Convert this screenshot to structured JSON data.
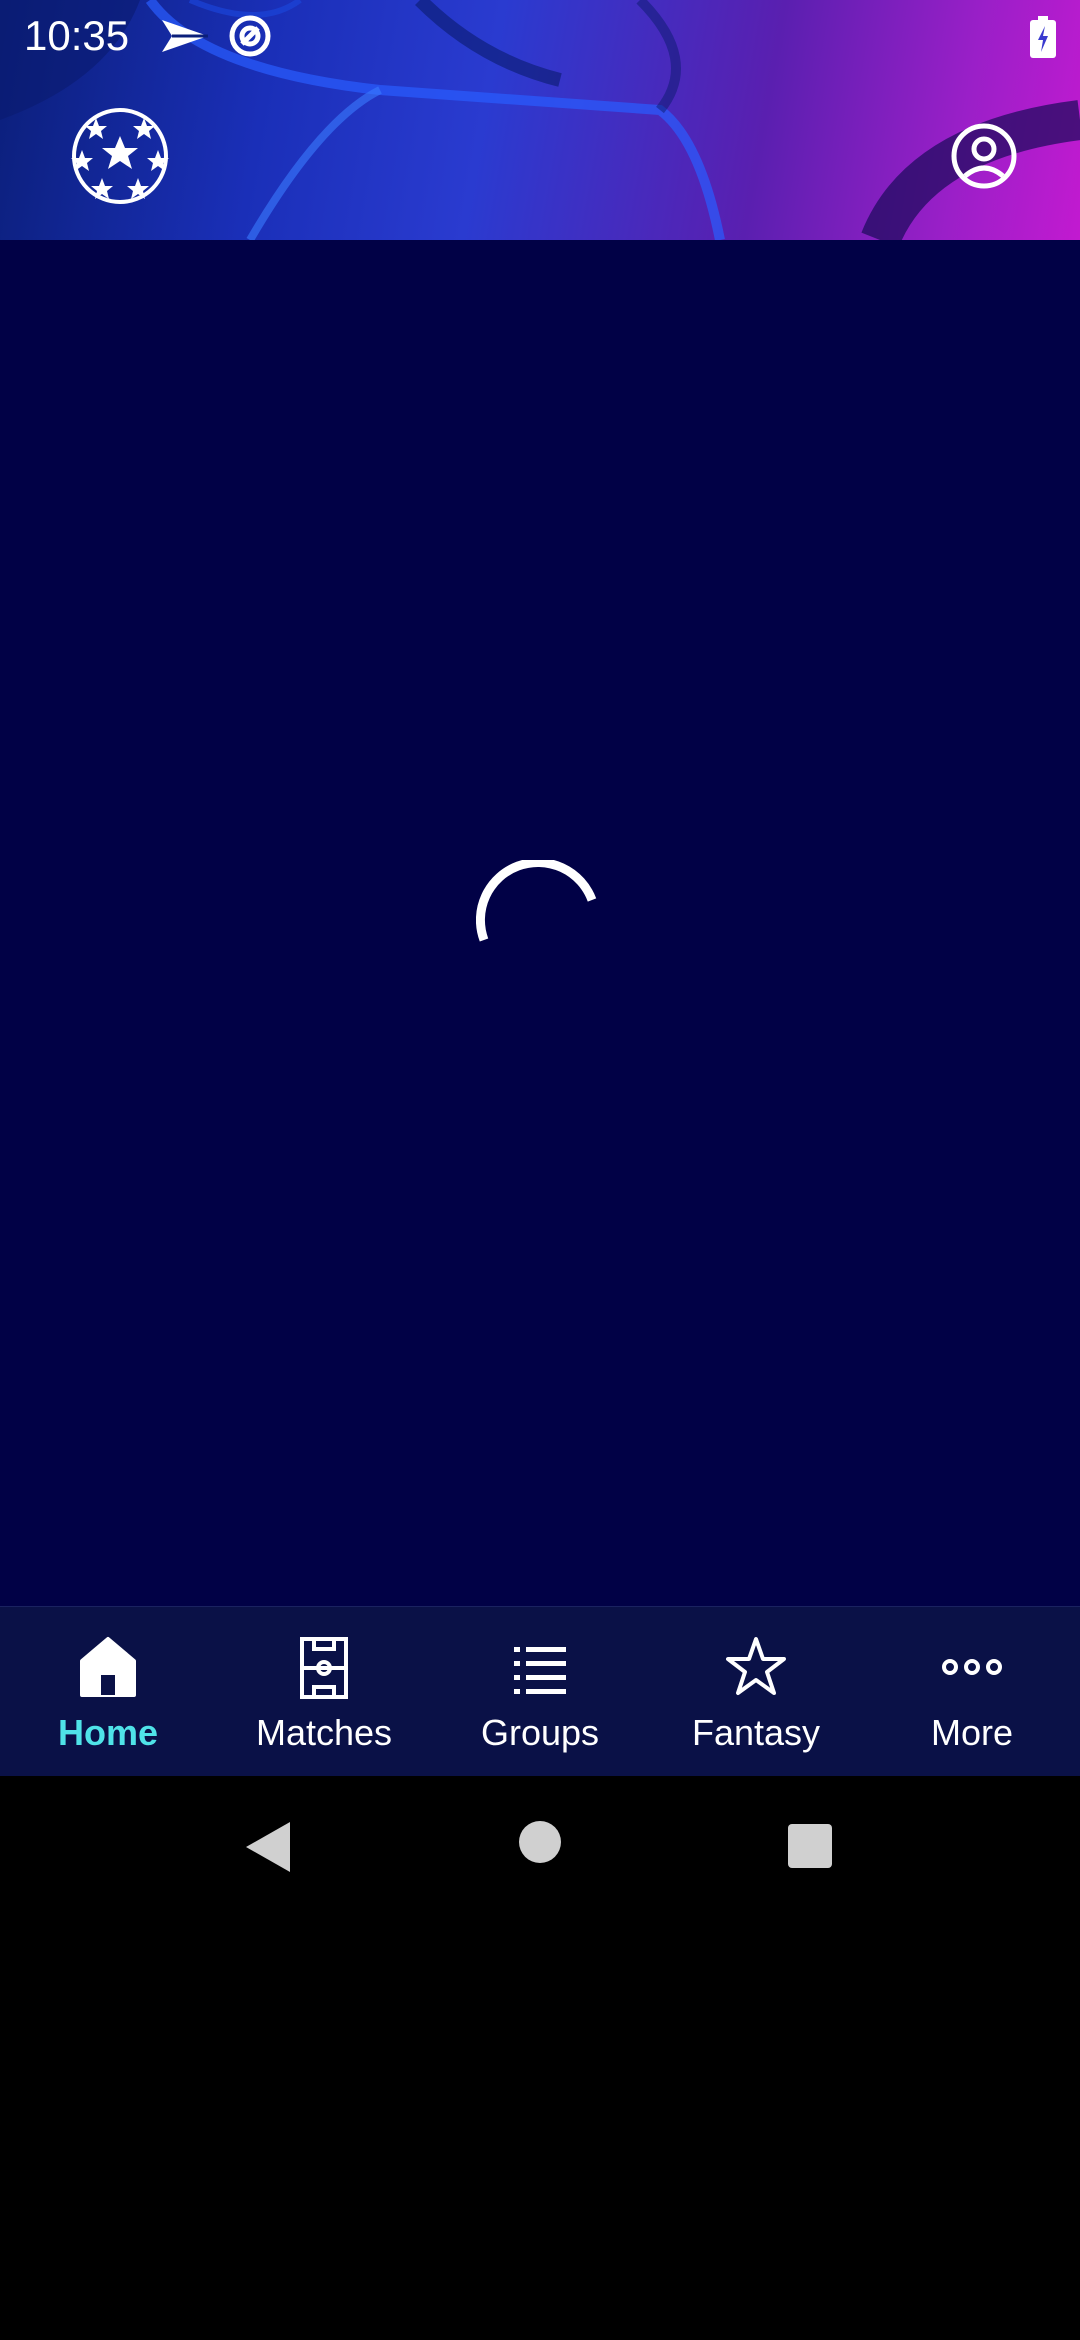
{
  "status_bar": {
    "time": "10:35",
    "icons": [
      "airplane-mode-icon",
      "data-saver-icon",
      "battery-charging-icon"
    ]
  },
  "header": {
    "logo_icon": "champions-league-starball-icon",
    "account_icon": "account-circle-icon"
  },
  "content": {
    "state": "loading",
    "loader_icon": "loading-spinner-icon"
  },
  "bottom_nav": {
    "active_color": "#4fe3e8",
    "items": [
      {
        "label": "Home",
        "icon": "home-icon",
        "active": true
      },
      {
        "label": "Matches",
        "icon": "pitch-icon",
        "active": false
      },
      {
        "label": "Groups",
        "icon": "list-icon",
        "active": false
      },
      {
        "label": "Fantasy",
        "icon": "star-icon",
        "active": false
      },
      {
        "label": "More",
        "icon": "more-dots-icon",
        "active": false
      }
    ]
  },
  "system_nav": {
    "buttons": [
      "back-icon",
      "home-circle-icon",
      "recents-icon"
    ]
  },
  "colors": {
    "content_background": "#010146",
    "nav_background": "#0a1147",
    "header_gradient_start": "#0b1f7a",
    "header_gradient_end": "#c21ad0"
  }
}
